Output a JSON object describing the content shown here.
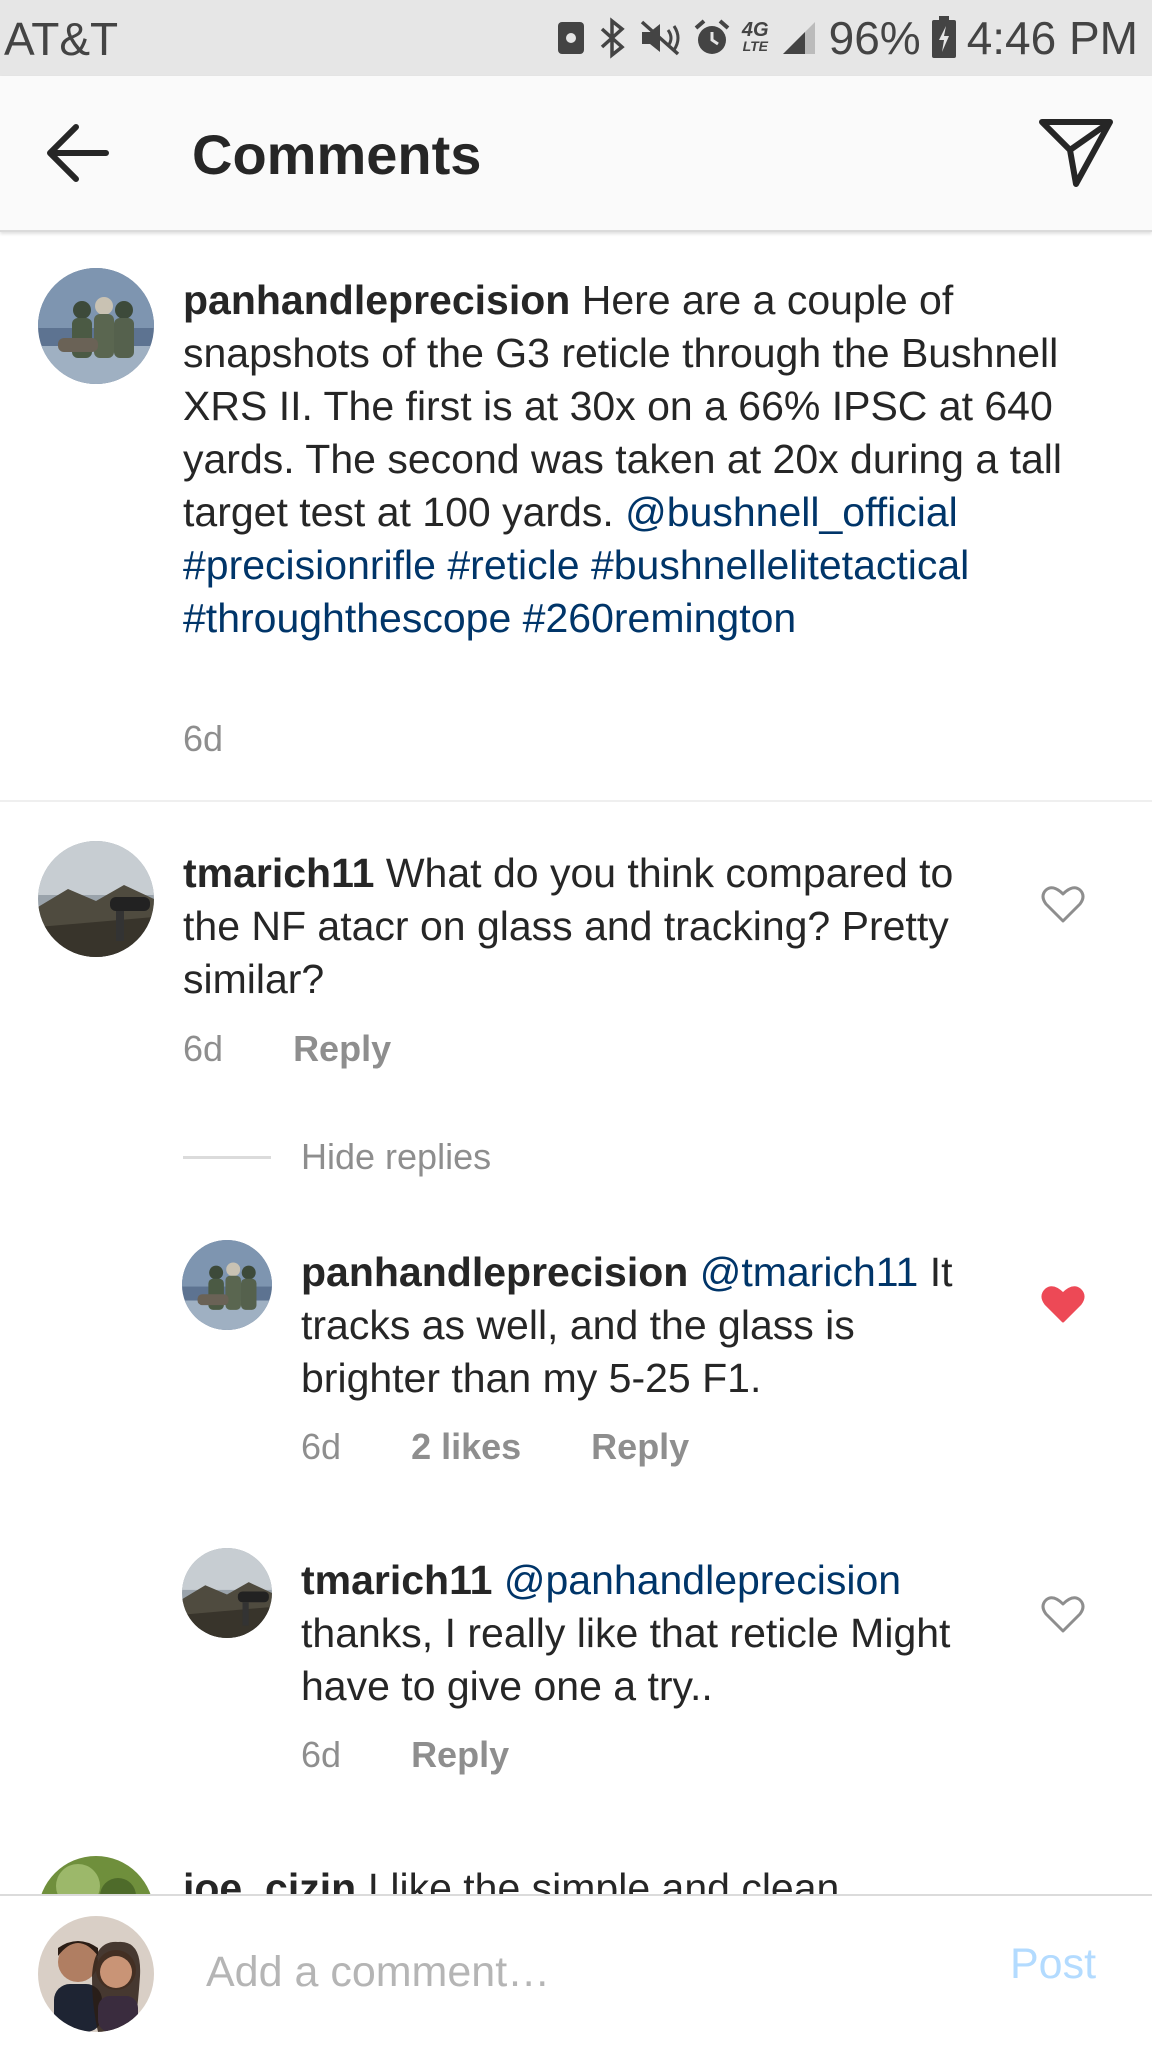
{
  "status_bar": {
    "carrier": "AT&T",
    "network": "4G",
    "network_sub": "LTE",
    "battery": "96%",
    "time": "4:46 PM",
    "icons": [
      "nfc-icon",
      "bluetooth-icon",
      "mute-icon",
      "alarm-icon",
      "lte-icon",
      "signal-icon",
      "battery-charging-icon"
    ]
  },
  "header": {
    "title": "Comments",
    "back_icon": "arrow-left-icon",
    "share_icon": "send-icon"
  },
  "caption": {
    "username": "panhandleprecision",
    "text": "Here are a couple of snapshots of the G3 reticle through the Bushnell XRS II. The first is at 30x on a 66% IPSC at 640 yards. The second was taken at 20x during a tall target test at 100 yards.",
    "tags": [
      "@bushnell_official",
      "#precisionrifle",
      "#reticle",
      "#bushnellelitetactical",
      "#throughthescope",
      "#260remington"
    ],
    "time": "6d"
  },
  "comments": [
    {
      "username": "tmarich11",
      "text": "What do you think compared to the NF atacr on glass and tracking? Pretty similar?",
      "time": "6d",
      "reply_label": "Reply",
      "liked": false
    }
  ],
  "hide_replies_label": "Hide replies",
  "replies": [
    {
      "username": "panhandleprecision",
      "mention": "@tmarich11",
      "text": "It tracks as well, and the glass is brighter than my 5-25 F1.",
      "time": "6d",
      "likes": "2 likes",
      "reply_label": "Reply",
      "liked": true
    },
    {
      "username": "tmarich11",
      "mention": "@panhandleprecision",
      "text": "thanks, I really like that reticle Might have to give one a try..",
      "time": "6d",
      "reply_label": "Reply",
      "liked": false
    }
  ],
  "partial_comment": {
    "username": "joe_cizin",
    "text": "I like the simple and clean"
  },
  "footer": {
    "placeholder": "Add a comment…",
    "post_label": "Post"
  },
  "colors": {
    "link": "#003569",
    "meta": "#8e8e8e",
    "liked_heart": "#ed4956",
    "post_disabled": "#b3dbff"
  }
}
